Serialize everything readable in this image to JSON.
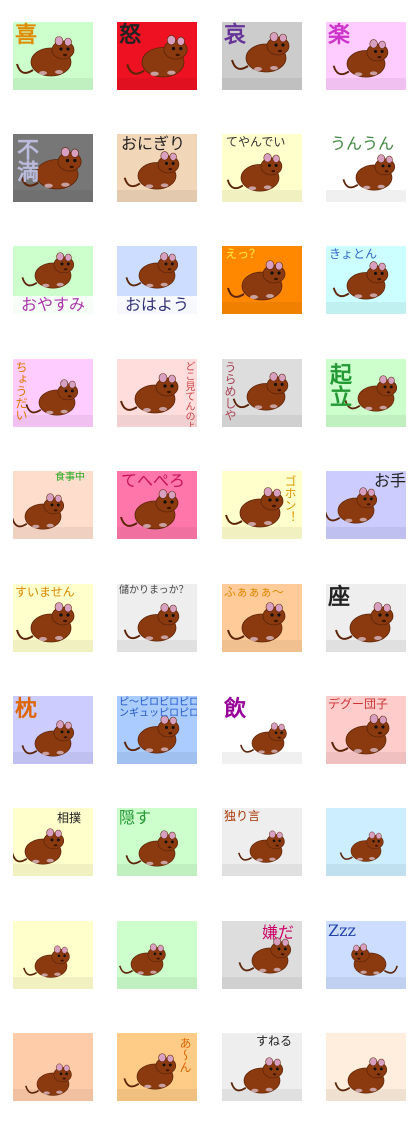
{
  "page": {
    "background": "#ffffff"
  },
  "stickers": [
    {
      "label": "喜",
      "bg": "#ccffcc",
      "label_color": "#e08c00"
    },
    {
      "label": "怒",
      "bg": "#ee1122",
      "label_color": "#222222"
    },
    {
      "label": "哀",
      "bg": "#cccccc",
      "label_color": "#663399"
    },
    {
      "label": "楽",
      "bg": "#ffccff",
      "label_color": "#cc33cc"
    },
    {
      "label": "不満",
      "bg": "#777777",
      "label_color": "#bbbbdd"
    },
    {
      "label": "おにぎり",
      "bg": "#f2d6b8",
      "label_color": "#222222"
    },
    {
      "label": "てやんでい",
      "bg": "#ffffcc",
      "label_color": "#333333"
    },
    {
      "label": "うんうん",
      "bg": "#ffffff",
      "label_color": "#448844"
    },
    {
      "label": "おやすみ",
      "bg": "#ccffcc",
      "label_color": "#aa33aa"
    },
    {
      "label": "おはよう",
      "bg": "#ccddff",
      "label_color": "#333377"
    },
    {
      "label": "えっ？",
      "bg": "#ff8800",
      "label_color": "#ffee44"
    },
    {
      "label": "きょとん",
      "bg": "#ccffff",
      "label_color": "#3366cc"
    },
    {
      "label": "ちょうだい",
      "bg": "#ffccff",
      "label_color": "#dd7700"
    },
    {
      "label": "どこ見てんのよ",
      "bg": "#ffdddd",
      "label_color": "#cc4444"
    },
    {
      "label": "うらめしや",
      "bg": "#dddddd",
      "label_color": "#aa4455"
    },
    {
      "label": "起立",
      "bg": "#ccffcc",
      "label_color": "#229933"
    },
    {
      "label": "食事中",
      "bg": "#ffddcc",
      "label_color": "#22aa22"
    },
    {
      "label": "てへぺろ",
      "bg": "#ff77aa",
      "label_color": "#cc1155"
    },
    {
      "label": "ゴホン！",
      "bg": "#ffffcc",
      "label_color": "#dd9900"
    },
    {
      "label": "お手",
      "bg": "#ccccff",
      "label_color": "#222222"
    },
    {
      "label": "すいません",
      "bg": "#ffffcc",
      "label_color": "#dd8800"
    },
    {
      "label": "儲かりまっか？",
      "bg": "#eeeeee",
      "label_color": "#444444"
    },
    {
      "label": "ふぁぁぁ〜",
      "bg": "#ffcc99",
      "label_color": "#dd8800"
    },
    {
      "label": "座",
      "bg": "#eeeeee",
      "label_color": "#222222"
    },
    {
      "label": "枕",
      "bg": "#ccccff",
      "label_color": "#dd6600"
    },
    {
      "label": "ピ〜ピロピロピロ ンギュッピロピロ",
      "label_line1": "ピ〜ピロピロピロ",
      "label_line2": "ンギュッピロピロ",
      "bg": "#aaccff",
      "label_color": "#2255cc"
    },
    {
      "label": "飲",
      "bg": "#ffffff",
      "label_color": "#990099"
    },
    {
      "label": "デグー団子",
      "bg": "#ffcccc",
      "label_color": "#cc3333"
    },
    {
      "label": "相撲",
      "bg": "#ffffcc",
      "label_color": "#222222"
    },
    {
      "label": "隠す",
      "bg": "#ccffcc",
      "label_color": "#229933"
    },
    {
      "label": "独り言",
      "bg": "#eeeeee",
      "label_color": "#aa3300"
    },
    {
      "label": "",
      "bg": "#cceeff",
      "label_color": "#222222"
    },
    {
      "label": "",
      "bg": "#ffffcc",
      "label_color": "#222222"
    },
    {
      "label": "",
      "bg": "#ccffcc",
      "label_color": "#222222"
    },
    {
      "label": "嫌だ",
      "bg": "#dddddd",
      "label_color": "#cc0066"
    },
    {
      "label": "Zzz",
      "bg": "#ccddff",
      "label_color": "#2244aa"
    },
    {
      "label": "",
      "bg": "#ffccaa",
      "label_color": "#222222"
    },
    {
      "label": "あ〜ん",
      "bg": "#ffcc88",
      "label_color": "#dd6600"
    },
    {
      "label": "すねる",
      "bg": "#eeeeee",
      "label_color": "#222222"
    },
    {
      "label": "",
      "bg": "#ffeedd",
      "label_color": "#222222"
    }
  ],
  "icons": {
    "animal": "degu-icon"
  },
  "colors": {
    "fur": "#8b3a0f",
    "fur_shadow": "#5c2408",
    "ear": "#d8a0c0",
    "eye": "#111111"
  }
}
